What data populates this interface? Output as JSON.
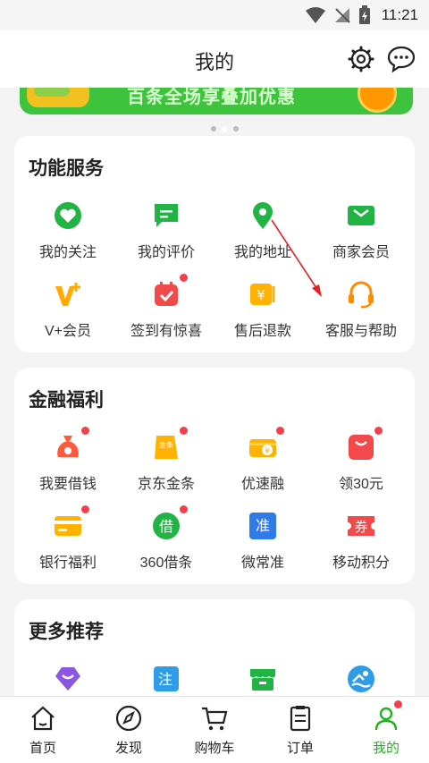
{
  "status": {
    "time": "11:21"
  },
  "header": {
    "title": "我的"
  },
  "banner": {
    "text": "百条全场享叠加优惠"
  },
  "sections": {
    "functions": {
      "title": "功能服务",
      "items": [
        {
          "label": "我的关注",
          "icon": "heart-icon"
        },
        {
          "label": "我的评价",
          "icon": "comment-icon"
        },
        {
          "label": "我的地址",
          "icon": "location-pin-icon"
        },
        {
          "label": "商家会员",
          "icon": "member-card-icon"
        },
        {
          "label": "V+会员",
          "icon": "vplus-icon"
        },
        {
          "label": "签到有惊喜",
          "icon": "calendar-check-icon"
        },
        {
          "label": "售后退款",
          "icon": "refund-icon"
        },
        {
          "label": "客服与帮助",
          "icon": "headset-icon"
        }
      ]
    },
    "finance": {
      "title": "金融福利",
      "items": [
        {
          "label": "我要借钱",
          "icon": "money-bag-icon"
        },
        {
          "label": "京东金条",
          "icon": "gold-bar-icon",
          "badge": "金条"
        },
        {
          "label": "优速融",
          "icon": "yen-card-icon"
        },
        {
          "label": "领30元",
          "icon": "red-envelope-icon"
        },
        {
          "label": "银行福利",
          "icon": "bank-card-icon"
        },
        {
          "label": "360借条",
          "icon": "loan-icon",
          "badge": "借"
        },
        {
          "label": "微常准",
          "icon": "weichangzhun-icon",
          "badge": "准"
        },
        {
          "label": "移动积分",
          "icon": "coupon-icon",
          "badge": "券"
        }
      ]
    },
    "more": {
      "title": "更多推荐",
      "items": [
        {
          "icon": "crown-icon"
        },
        {
          "icon": "note-icon",
          "badge": "注"
        },
        {
          "icon": "store-icon"
        },
        {
          "icon": "swim-icon"
        }
      ]
    }
  },
  "tabbar": {
    "items": [
      {
        "label": "首页",
        "icon": "home-icon"
      },
      {
        "label": "发现",
        "icon": "compass-icon"
      },
      {
        "label": "购物车",
        "icon": "cart-icon"
      },
      {
        "label": "订单",
        "icon": "order-icon"
      },
      {
        "label": "我的",
        "icon": "profile-icon",
        "active": true
      }
    ]
  },
  "colors": {
    "brand_green": "#1fb51f",
    "badge_red": "#f2414b",
    "arrow_red": "#e52222"
  }
}
